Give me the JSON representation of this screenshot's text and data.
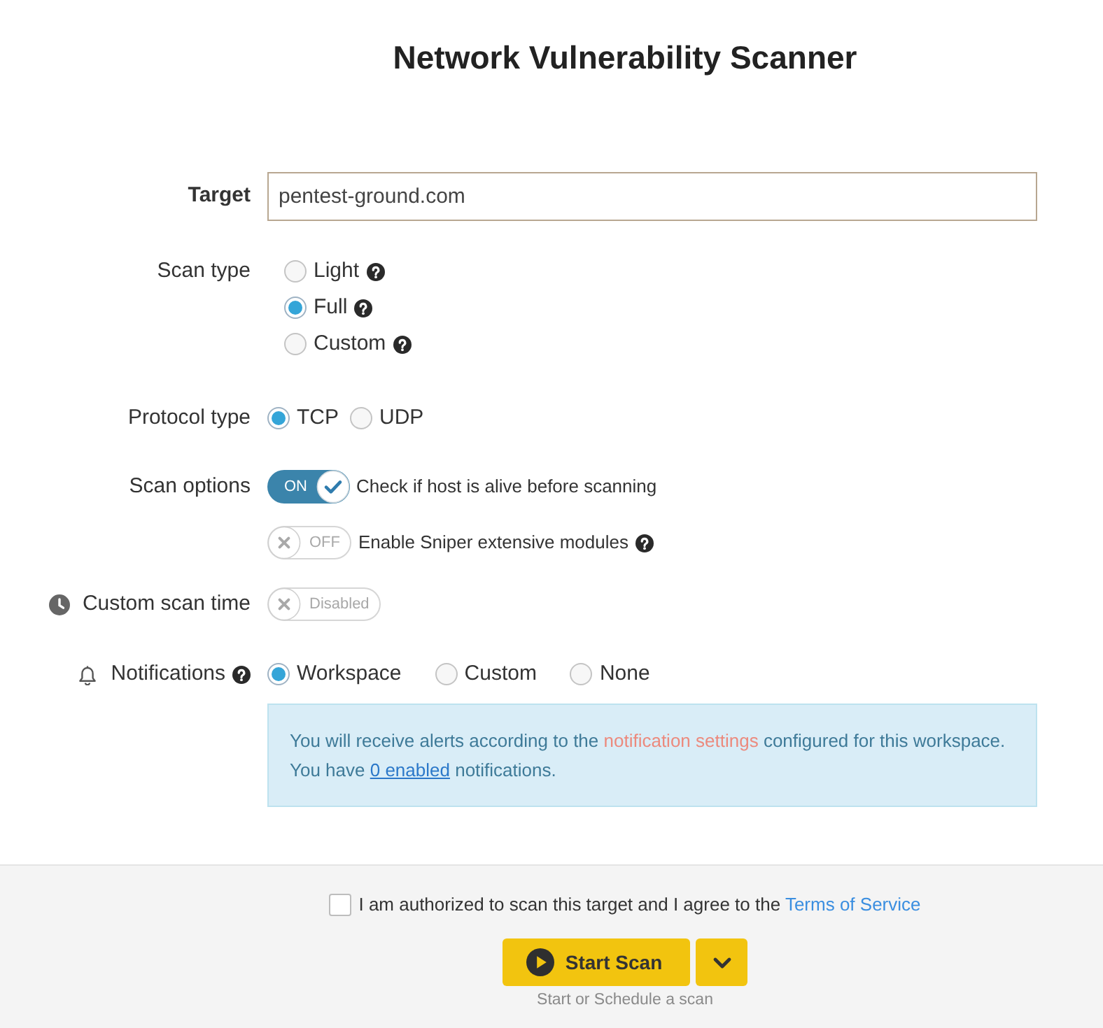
{
  "title": "Network Vulnerability Scanner",
  "target": {
    "label": "Target",
    "value": "pentest-ground.com"
  },
  "scan_type": {
    "label": "Scan type",
    "options": [
      {
        "label": "Light",
        "selected": false,
        "help": true
      },
      {
        "label": "Full",
        "selected": true,
        "help": true
      },
      {
        "label": "Custom",
        "selected": false,
        "help": true
      }
    ]
  },
  "protocol_type": {
    "label": "Protocol type",
    "options": [
      {
        "label": "TCP",
        "selected": true
      },
      {
        "label": "UDP",
        "selected": false
      }
    ]
  },
  "scan_options": {
    "label": "Scan options",
    "toggles": [
      {
        "on": true,
        "state_text": "ON",
        "label": "Check if host is alive before scanning",
        "help": false
      },
      {
        "on": false,
        "state_text": "OFF",
        "label": "Enable Sniper extensive modules",
        "help": true
      }
    ]
  },
  "custom_scan_time": {
    "label": "Custom scan time",
    "on": false,
    "state_text": "Disabled"
  },
  "notifications": {
    "label": "Notifications",
    "help": true,
    "options": [
      {
        "label": "Workspace",
        "selected": true
      },
      {
        "label": "Custom",
        "selected": false
      },
      {
        "label": "None",
        "selected": false
      }
    ],
    "info_lines": [
      [
        {
          "kind": "text",
          "text": "You will receive alerts according to the "
        },
        {
          "kind": "highlight",
          "text": "notification settings"
        },
        {
          "kind": "text",
          "text": " configured for this workspace."
        }
      ],
      [
        {
          "kind": "text",
          "text": "You have "
        },
        {
          "kind": "link",
          "text": "0 enabled"
        },
        {
          "kind": "text",
          "text": " notifications."
        }
      ]
    ]
  },
  "footer": {
    "agree": {
      "checked": false,
      "text": "I am authorized to scan this target and I agree to the ",
      "link": "Terms of Service"
    },
    "start_button": "Start Scan",
    "caption": "Start or Schedule a scan"
  }
}
